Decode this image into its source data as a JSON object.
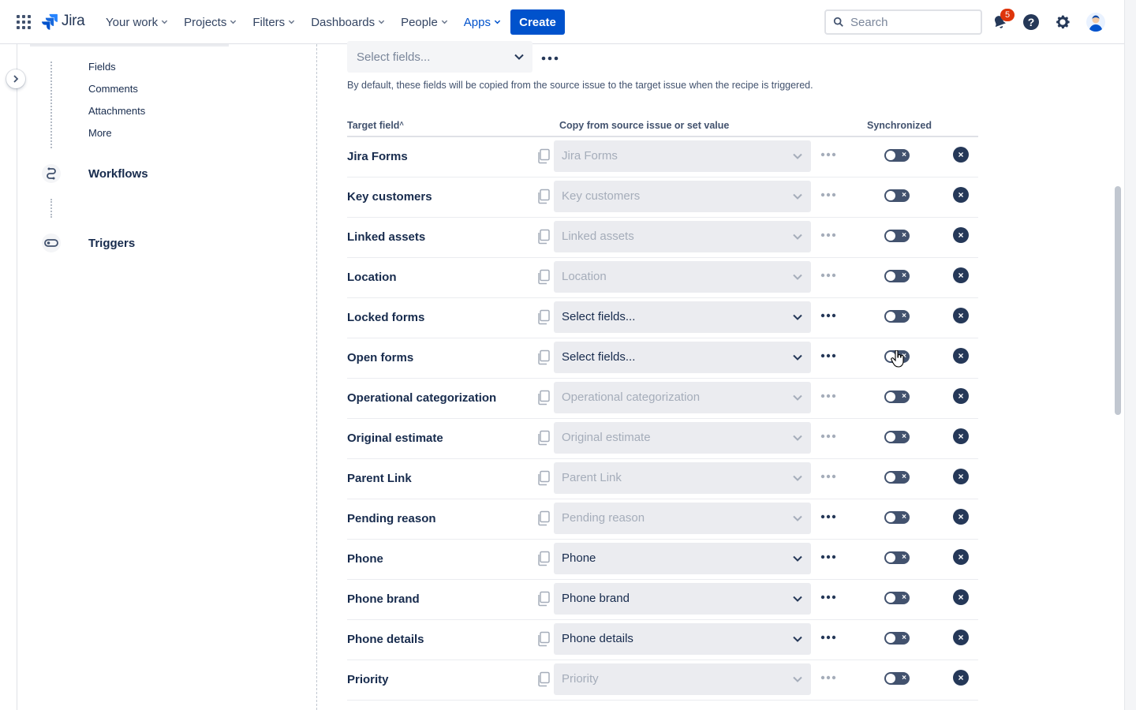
{
  "nav": {
    "logo_text": "Jira",
    "items": [
      {
        "label": "Your work",
        "active": false
      },
      {
        "label": "Projects",
        "active": false
      },
      {
        "label": "Filters",
        "active": false
      },
      {
        "label": "Dashboards",
        "active": false
      },
      {
        "label": "People",
        "active": false
      },
      {
        "label": "Apps",
        "active": true
      }
    ],
    "create_label": "Create",
    "search_placeholder": "Search",
    "notification_count": "5",
    "icons": [
      "app-switcher-icon",
      "jira-logo-icon",
      "search-icon",
      "notification-bell-icon",
      "help-icon",
      "settings-gear-icon",
      "user-avatar"
    ]
  },
  "sidebar": {
    "subitems": [
      "Fields",
      "Comments",
      "Attachments",
      "More"
    ],
    "sections": [
      {
        "label": "Workflows",
        "icon": "workflow-icon"
      },
      {
        "label": "Triggers",
        "icon": "toggle-trigger-icon"
      }
    ]
  },
  "main": {
    "select_fields_placeholder": "Select fields...",
    "description": "By default, these fields will be copied from the source issue to the target issue when the recipe is triggered.",
    "columns": {
      "target": "Target field",
      "target_sort_indicator": "˄",
      "copy": "Copy from source issue or set value",
      "sync": "Synchronized"
    },
    "rows": [
      {
        "label": "Jira Forms",
        "value": "Jira Forms",
        "enabled": false
      },
      {
        "label": "Key customers",
        "value": "Key customers",
        "enabled": false
      },
      {
        "label": "Linked assets",
        "value": "Linked assets",
        "enabled": false
      },
      {
        "label": "Location",
        "value": "Location",
        "enabled": false
      },
      {
        "label": "Locked forms",
        "value": "Select fields...",
        "enabled": true
      },
      {
        "label": "Open forms",
        "value": "Select fields...",
        "enabled": true
      },
      {
        "label": "Operational categorization",
        "value": "Operational categorization",
        "enabled": false
      },
      {
        "label": "Original estimate",
        "value": "Original estimate",
        "enabled": false
      },
      {
        "label": "Parent Link",
        "value": "Parent Link",
        "enabled": false
      },
      {
        "label": "Pending reason",
        "value": "Pending reason",
        "enabled": false,
        "dots_active": true
      },
      {
        "label": "Phone",
        "value": "Phone",
        "enabled": true
      },
      {
        "label": "Phone brand",
        "value": "Phone brand",
        "enabled": true
      },
      {
        "label": "Phone details",
        "value": "Phone details",
        "enabled": true
      },
      {
        "label": "Priority",
        "value": "Priority",
        "enabled": false
      }
    ],
    "toggle_off_glyph": "×",
    "remove_glyph": "×"
  },
  "colors": {
    "brand": "#0052cc",
    "text": "#172b4d",
    "muted": "#a5adba",
    "toggle_off": "#42526e",
    "badge": "#de350b"
  }
}
